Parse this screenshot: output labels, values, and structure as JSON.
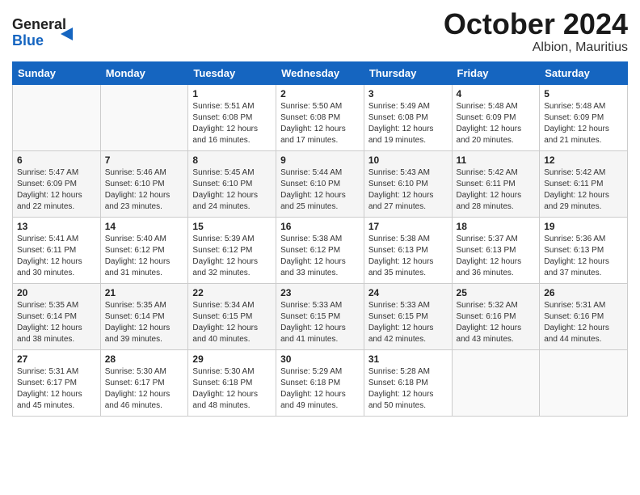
{
  "logo": {
    "line1": "General",
    "line2": "Blue"
  },
  "title": "October 2024",
  "subtitle": "Albion, Mauritius",
  "days_of_week": [
    "Sunday",
    "Monday",
    "Tuesday",
    "Wednesday",
    "Thursday",
    "Friday",
    "Saturday"
  ],
  "weeks": [
    [
      {
        "day": "",
        "info": ""
      },
      {
        "day": "",
        "info": ""
      },
      {
        "day": "1",
        "info": "Sunrise: 5:51 AM\nSunset: 6:08 PM\nDaylight: 12 hours and 16 minutes."
      },
      {
        "day": "2",
        "info": "Sunrise: 5:50 AM\nSunset: 6:08 PM\nDaylight: 12 hours and 17 minutes."
      },
      {
        "day": "3",
        "info": "Sunrise: 5:49 AM\nSunset: 6:08 PM\nDaylight: 12 hours and 19 minutes."
      },
      {
        "day": "4",
        "info": "Sunrise: 5:48 AM\nSunset: 6:09 PM\nDaylight: 12 hours and 20 minutes."
      },
      {
        "day": "5",
        "info": "Sunrise: 5:48 AM\nSunset: 6:09 PM\nDaylight: 12 hours and 21 minutes."
      }
    ],
    [
      {
        "day": "6",
        "info": "Sunrise: 5:47 AM\nSunset: 6:09 PM\nDaylight: 12 hours and 22 minutes."
      },
      {
        "day": "7",
        "info": "Sunrise: 5:46 AM\nSunset: 6:10 PM\nDaylight: 12 hours and 23 minutes."
      },
      {
        "day": "8",
        "info": "Sunrise: 5:45 AM\nSunset: 6:10 PM\nDaylight: 12 hours and 24 minutes."
      },
      {
        "day": "9",
        "info": "Sunrise: 5:44 AM\nSunset: 6:10 PM\nDaylight: 12 hours and 25 minutes."
      },
      {
        "day": "10",
        "info": "Sunrise: 5:43 AM\nSunset: 6:10 PM\nDaylight: 12 hours and 27 minutes."
      },
      {
        "day": "11",
        "info": "Sunrise: 5:42 AM\nSunset: 6:11 PM\nDaylight: 12 hours and 28 minutes."
      },
      {
        "day": "12",
        "info": "Sunrise: 5:42 AM\nSunset: 6:11 PM\nDaylight: 12 hours and 29 minutes."
      }
    ],
    [
      {
        "day": "13",
        "info": "Sunrise: 5:41 AM\nSunset: 6:11 PM\nDaylight: 12 hours and 30 minutes."
      },
      {
        "day": "14",
        "info": "Sunrise: 5:40 AM\nSunset: 6:12 PM\nDaylight: 12 hours and 31 minutes."
      },
      {
        "day": "15",
        "info": "Sunrise: 5:39 AM\nSunset: 6:12 PM\nDaylight: 12 hours and 32 minutes."
      },
      {
        "day": "16",
        "info": "Sunrise: 5:38 AM\nSunset: 6:12 PM\nDaylight: 12 hours and 33 minutes."
      },
      {
        "day": "17",
        "info": "Sunrise: 5:38 AM\nSunset: 6:13 PM\nDaylight: 12 hours and 35 minutes."
      },
      {
        "day": "18",
        "info": "Sunrise: 5:37 AM\nSunset: 6:13 PM\nDaylight: 12 hours and 36 minutes."
      },
      {
        "day": "19",
        "info": "Sunrise: 5:36 AM\nSunset: 6:13 PM\nDaylight: 12 hours and 37 minutes."
      }
    ],
    [
      {
        "day": "20",
        "info": "Sunrise: 5:35 AM\nSunset: 6:14 PM\nDaylight: 12 hours and 38 minutes."
      },
      {
        "day": "21",
        "info": "Sunrise: 5:35 AM\nSunset: 6:14 PM\nDaylight: 12 hours and 39 minutes."
      },
      {
        "day": "22",
        "info": "Sunrise: 5:34 AM\nSunset: 6:15 PM\nDaylight: 12 hours and 40 minutes."
      },
      {
        "day": "23",
        "info": "Sunrise: 5:33 AM\nSunset: 6:15 PM\nDaylight: 12 hours and 41 minutes."
      },
      {
        "day": "24",
        "info": "Sunrise: 5:33 AM\nSunset: 6:15 PM\nDaylight: 12 hours and 42 minutes."
      },
      {
        "day": "25",
        "info": "Sunrise: 5:32 AM\nSunset: 6:16 PM\nDaylight: 12 hours and 43 minutes."
      },
      {
        "day": "26",
        "info": "Sunrise: 5:31 AM\nSunset: 6:16 PM\nDaylight: 12 hours and 44 minutes."
      }
    ],
    [
      {
        "day": "27",
        "info": "Sunrise: 5:31 AM\nSunset: 6:17 PM\nDaylight: 12 hours and 45 minutes."
      },
      {
        "day": "28",
        "info": "Sunrise: 5:30 AM\nSunset: 6:17 PM\nDaylight: 12 hours and 46 minutes."
      },
      {
        "day": "29",
        "info": "Sunrise: 5:30 AM\nSunset: 6:18 PM\nDaylight: 12 hours and 48 minutes."
      },
      {
        "day": "30",
        "info": "Sunrise: 5:29 AM\nSunset: 6:18 PM\nDaylight: 12 hours and 49 minutes."
      },
      {
        "day": "31",
        "info": "Sunrise: 5:28 AM\nSunset: 6:18 PM\nDaylight: 12 hours and 50 minutes."
      },
      {
        "day": "",
        "info": ""
      },
      {
        "day": "",
        "info": ""
      }
    ]
  ]
}
